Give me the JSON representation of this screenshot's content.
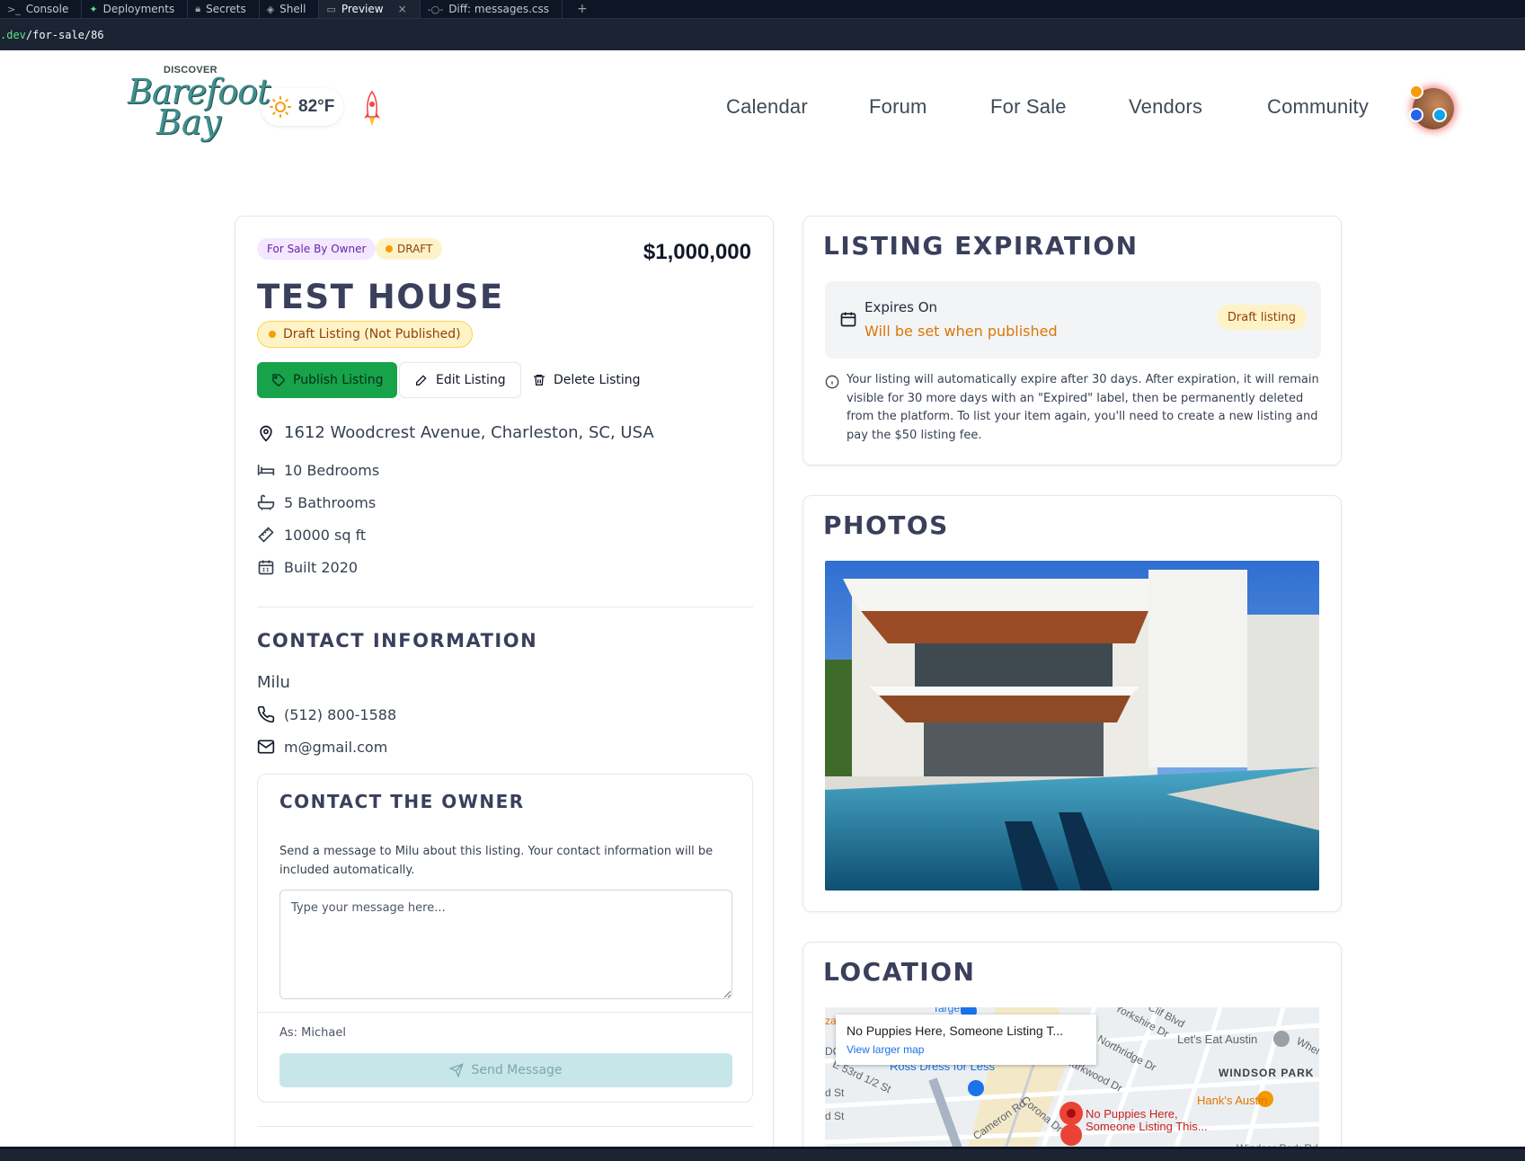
{
  "ide": {
    "tabs": [
      {
        "label": "Console",
        "icon": "terminal-icon"
      },
      {
        "label": "Deployments",
        "icon": "deploy-icon"
      },
      {
        "label": "Secrets",
        "icon": "lock-icon"
      },
      {
        "label": "Shell",
        "icon": "shell-icon"
      },
      {
        "label": "Preview",
        "icon": "monitor-icon",
        "active": true
      },
      {
        "label": "Diff: messages.css",
        "icon": "diff-icon"
      }
    ],
    "url_domain": ".dev",
    "url_path": "/for-sale/86",
    "new_tab": "+",
    "close": "×"
  },
  "header": {
    "logo_top": "DISCOVER",
    "logo_line1": "Barefoot",
    "logo_line2": "Bay",
    "weather": "82°F",
    "nav": [
      "Calendar",
      "Forum",
      "For Sale",
      "Vendors",
      "Community"
    ]
  },
  "listing": {
    "badge_type": "For Sale By Owner",
    "badge_status": "DRAFT",
    "price": "$1,000,000",
    "title": "TEST HOUSE",
    "draft_notice": "Draft Listing (Not Published)",
    "actions": {
      "publish": "Publish Listing",
      "edit": "Edit Listing",
      "delete": "Delete Listing"
    },
    "address": "1612 Woodcrest Avenue, Charleston, SC, USA",
    "bedrooms": "10 Bedrooms",
    "bathrooms": "5 Bathrooms",
    "area": "10000 sq ft",
    "built": "Built 2020"
  },
  "contact": {
    "heading": "CONTACT INFORMATION",
    "name": "Milu",
    "phone": "(512) 800-1588",
    "email": "m@gmail.com"
  },
  "contact_owner": {
    "heading": "CONTACT THE OWNER",
    "description": "Send a message to Milu about this listing. Your contact information will be included automatically.",
    "placeholder": "Type your message here...",
    "as_user": "As: Michael",
    "send": "Send Message"
  },
  "expiration": {
    "heading": "LISTING EXPIRATION",
    "label": "Expires On",
    "value": "Will be set when published",
    "tag": "Draft listing",
    "note": "Your listing will automatically expire after 30 days. After expiration, it will remain visible for 30 more days with an \"Expired\" label, then be permanently deleted from the platform. To list your item again, you'll need to create a new listing and pay the $50 listing fee."
  },
  "photos": {
    "heading": "PHOTOS"
  },
  "location": {
    "heading": "LOCATION",
    "popup_title": "No Puppies Here, Someone Listing T...",
    "popup_link": "View larger map",
    "labels": {
      "target": "Target",
      "ross": "Ross Dress for Less",
      "lets_eat": "Let's Eat Austin",
      "windsor": "WINDSOR PARK",
      "hanks": "Hank's Austin",
      "pin1": "No Puppies Here,",
      "pin2": "Someone Listing This...",
      "yorkshire": "Yorkshire Dr",
      "larkwood": "Larkwood Dr",
      "cameron": "Cameron Rd",
      "corona": "Corona Dr",
      "e53": "E 53rd 1/2 St",
      "northridge": "Northridge Dr",
      "whelless": "Whel",
      "clif": "Clif Blvd",
      "windsor_rd": "Windsor Park Rd",
      "za": "za",
      "d_st": "d St",
      "dc": "DC"
    }
  },
  "colors": {
    "primary_green": "#16a34a",
    "heading": "#3a3f5c",
    "amber": "#d97706"
  }
}
